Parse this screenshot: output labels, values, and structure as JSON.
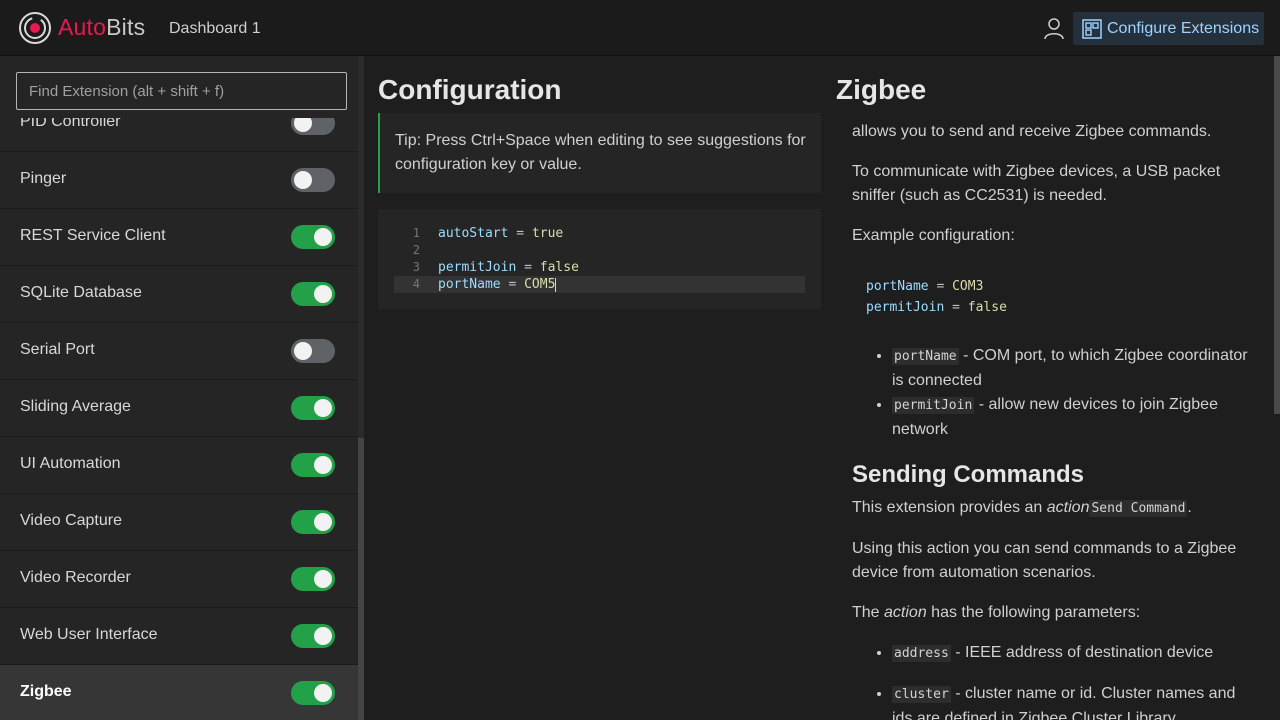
{
  "header": {
    "brand_auto": "Auto",
    "brand_bits": "Bits",
    "dashboard_title": "Dashboard 1",
    "configure_label": "Configure Extensions"
  },
  "sidebar": {
    "search_placeholder": "Find Extension (alt + shift + f)",
    "items": [
      {
        "label": "PID Controller",
        "enabled": false
      },
      {
        "label": "Pinger",
        "enabled": false
      },
      {
        "label": "REST Service Client",
        "enabled": true
      },
      {
        "label": "SQLite Database",
        "enabled": true
      },
      {
        "label": "Serial Port",
        "enabled": false
      },
      {
        "label": "Sliding Average",
        "enabled": true
      },
      {
        "label": "UI Automation",
        "enabled": true
      },
      {
        "label": "Video Capture",
        "enabled": true
      },
      {
        "label": "Video Recorder",
        "enabled": true
      },
      {
        "label": "Web User Interface",
        "enabled": true
      },
      {
        "label": "Zigbee",
        "enabled": true,
        "selected": true
      }
    ]
  },
  "config": {
    "title": "Configuration",
    "tip": "Tip: Press Ctrl+Space when editing to see suggestions for configuration key or value.",
    "lines": [
      {
        "n": "1",
        "key": "autoStart",
        "value": "true"
      },
      {
        "n": "2",
        "key": "",
        "value": ""
      },
      {
        "n": "3",
        "key": "permitJoin",
        "value": "false"
      },
      {
        "n": "4",
        "key": "portName",
        "value": "COM5"
      }
    ]
  },
  "docs": {
    "title": "Zigbee",
    "intro": "allows you to send and receive Zigbee commands.",
    "sniffer": "To communicate with Zigbee devices, a USB packet sniffer (such as CC2531) is needed.",
    "example_label": "Example configuration:",
    "example": [
      {
        "key": "portName",
        "value": "COM3"
      },
      {
        "key": "permitJoin",
        "value": "false"
      }
    ],
    "params": [
      {
        "code": "portName",
        "text": " - COM port, to which Zigbee coordinator is connected"
      },
      {
        "code": "permitJoin",
        "text": " - allow new devices to join Zigbee network"
      }
    ],
    "section_title": "Sending Commands",
    "provides_pre": "This extension provides an ",
    "provides_em": "action",
    "provides_code": "Send Command",
    "provides_post": ".",
    "using": "Using this action you can send commands to a Zigbee device from automation scenarios.",
    "action_pre": "The ",
    "action_em": "action",
    "action_post": " has the following parameters:",
    "action_params": [
      {
        "code": "address",
        "text": " - IEEE address of destination device"
      },
      {
        "code": "cluster",
        "text": " - cluster name or id. Cluster names and ids are defined in Zigbee Cluster Library"
      }
    ]
  },
  "colors": {
    "brand": "#e8194e",
    "toggle_on": "#23a148",
    "toggle_off": "#5f6368",
    "accent_link": "#9fd3ff"
  }
}
